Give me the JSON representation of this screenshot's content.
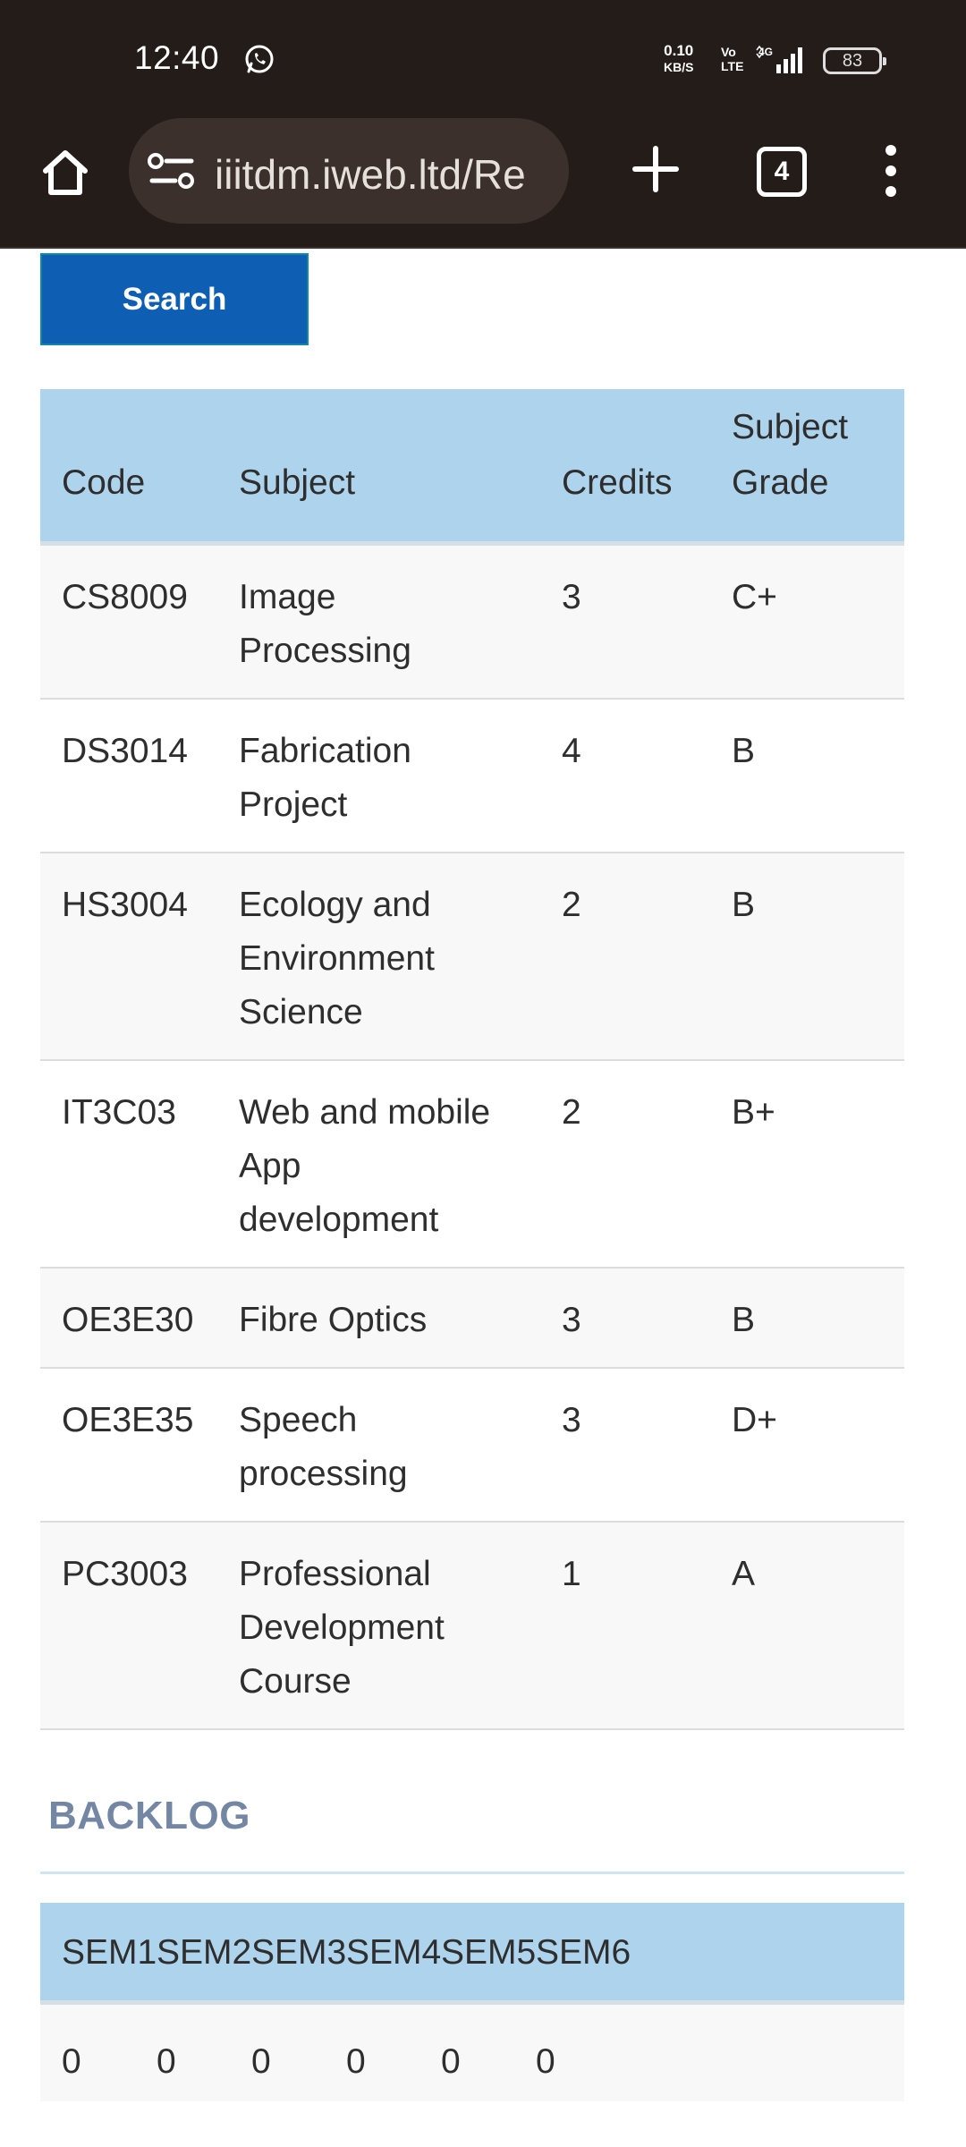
{
  "status_bar": {
    "time": "12:40",
    "net_speed_value": "0.10",
    "net_speed_unit": "KB/S",
    "volte_top": "Vo",
    "volte_bottom": "LTE",
    "network_type": "4G",
    "battery": "83"
  },
  "browser": {
    "url": "iiitdm.iweb.ltd/Re",
    "tab_count": "4"
  },
  "search_button_label": "Search",
  "grades": {
    "headers": {
      "code": "Code",
      "subject": "Subject",
      "credits": "Credits",
      "grade_line1": "Subject",
      "grade_line2": "Grade"
    },
    "rows": [
      {
        "code": "CS8009",
        "subject": [
          "Image",
          "Processing"
        ],
        "credits": "3",
        "grade": "C+"
      },
      {
        "code": "DS3014",
        "subject": [
          "Fabrication",
          "Project"
        ],
        "credits": "4",
        "grade": "B"
      },
      {
        "code": "HS3004",
        "subject": [
          "Ecology and",
          "Environment",
          "Science"
        ],
        "credits": "2",
        "grade": "B"
      },
      {
        "code": "IT3C03",
        "subject": [
          "Web and mobile",
          "App",
          "development"
        ],
        "credits": "2",
        "grade": "B+"
      },
      {
        "code": "OE3E30",
        "subject": [
          "Fibre Optics"
        ],
        "credits": "3",
        "grade": "B"
      },
      {
        "code": "OE3E35",
        "subject": [
          "Speech",
          "processing"
        ],
        "credits": "3",
        "grade": "D+"
      },
      {
        "code": "PC3003",
        "subject": [
          "Professional",
          "Development",
          "Course"
        ],
        "credits": "1",
        "grade": "A"
      }
    ]
  },
  "backlog": {
    "title": "BACKLOG",
    "headers": [
      "SEM1",
      "SEM2",
      "SEM3",
      "SEM4",
      "SEM5",
      "SEM6"
    ],
    "values": [
      "0",
      "0",
      "0",
      "0",
      "0",
      "0"
    ]
  }
}
